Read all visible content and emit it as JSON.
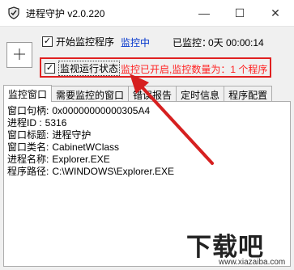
{
  "window": {
    "title": "进程守护 v2.0.220",
    "minimize_glyph": "—",
    "maximize_glyph": "☐",
    "close_glyph": "✕"
  },
  "controls": {
    "start_monitor_label": "开始监控程序",
    "start_monitor_checked": true,
    "monitor_status": "监控中",
    "monitored_label": "已监控：",
    "monitored_duration": "0天 00:00:14",
    "watch_state_label": "监视运行状态",
    "watch_state_checked": true,
    "watch_state_status": "监控已开启,监控数量为：1 个程序"
  },
  "tabs": [
    {
      "label": "监控窗口",
      "active": true
    },
    {
      "label": "需要监控的窗口",
      "active": false
    },
    {
      "label": "错误报告",
      "active": false
    },
    {
      "label": "定时信息",
      "active": false
    },
    {
      "label": "程序配置",
      "active": false
    }
  ],
  "window_info": [
    {
      "label": "窗口句柄:",
      "value": "0x00000000000305A4"
    },
    {
      "label": "进程ID  :",
      "value": "5316"
    },
    {
      "label": "窗口标题:",
      "value": "进程守护"
    },
    {
      "label": "窗口类名:",
      "value": "CabinetWClass"
    },
    {
      "label": "进程名称:",
      "value": "Explorer.EXE"
    },
    {
      "label": "程序路径:",
      "value": "C:\\WINDOWS\\Explorer.EXE"
    }
  ],
  "watermark": {
    "text": "下载吧",
    "url": "www.xiazaiba.com"
  },
  "colors": {
    "status_blue": "#0033cc",
    "status_red": "#ff2020",
    "highlight_frame": "#e02020"
  },
  "icons": {
    "app": "shield-icon",
    "crosshair": "crosshair-icon"
  }
}
